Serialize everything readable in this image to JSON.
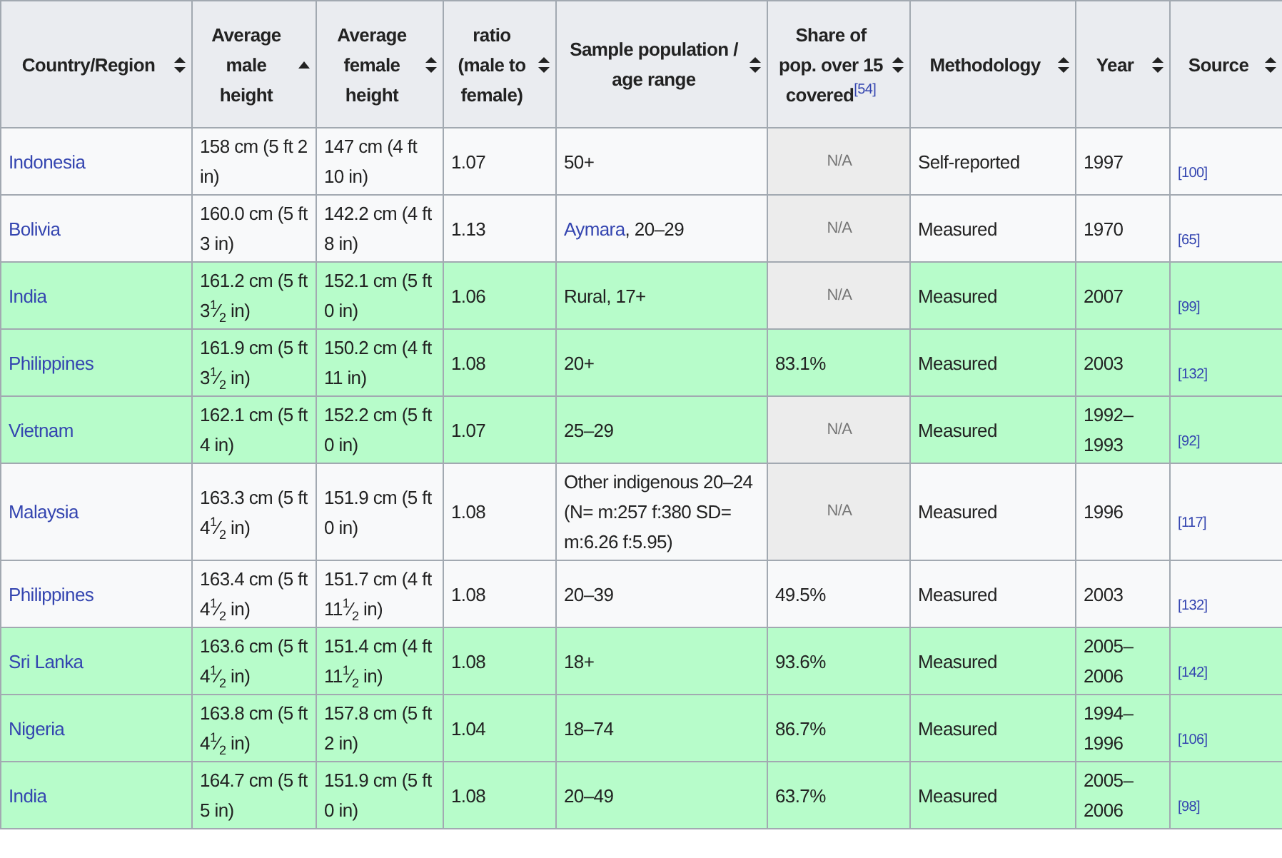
{
  "table": {
    "columns": [
      {
        "label": "Country/Region",
        "sorted": false
      },
      {
        "label": "Average male height",
        "sorted": true
      },
      {
        "label": "Average female height",
        "sorted": false
      },
      {
        "label": "ratio (male to female)",
        "sorted": false
      },
      {
        "label": "Sample population / age range",
        "sorted": false
      },
      {
        "label": "Share of pop. over 15 covered$^{[54]}$",
        "sorted": false
      },
      {
        "label": "Methodology",
        "sorted": false
      },
      {
        "label": "Year",
        "sorted": false
      },
      {
        "label": "Source",
        "sorted": false
      }
    ],
    "rows": [
      {
        "highlight": false,
        "country": "Indonesia",
        "male": "158 cm (5 ft 2 in)",
        "female": "147 cm (4 ft 10 in)",
        "ratio": "1.07",
        "sample": [
          {
            "text": "50+",
            "link": false
          }
        ],
        "share": {
          "kind": "na",
          "text": "N/A"
        },
        "method": "Self-reported",
        "year": "1997",
        "source": "[100]"
      },
      {
        "highlight": false,
        "country": "Bolivia",
        "male": "160.0 cm (5 ft 3 in)",
        "female": "142.2 cm (4 ft 8 in)",
        "ratio": "1.13",
        "sample": [
          {
            "text": "Aymara",
            "link": true
          },
          {
            "text": ", 20–29",
            "link": false
          }
        ],
        "share": {
          "kind": "na",
          "text": "N/A"
        },
        "method": "Measured",
        "year": "1970",
        "source": "[65]"
      },
      {
        "highlight": true,
        "country": "India",
        "male": "161.2 cm (5 ft 3$^{1}$⁄$_{2}$ in)",
        "female": "152.1 cm (5 ft 0 in)",
        "ratio": "1.06",
        "sample": [
          {
            "text": "Rural, 17+",
            "link": false
          }
        ],
        "share": {
          "kind": "na",
          "text": "N/A"
        },
        "method": "Measured",
        "year": "2007",
        "source": "[99]"
      },
      {
        "highlight": true,
        "country": "Philippines",
        "male": "161.9 cm (5 ft 3$^{1}$⁄$_{2}$ in)",
        "female": "150.2 cm (4 ft 11 in)",
        "ratio": "1.08",
        "sample": [
          {
            "text": "20+",
            "link": false
          }
        ],
        "share": {
          "kind": "value",
          "text": "83.1%"
        },
        "method": "Measured",
        "year": "2003",
        "source": "[132]"
      },
      {
        "highlight": true,
        "country": "Vietnam",
        "male": "162.1 cm (5 ft 4 in)",
        "female": "152.2 cm (5 ft 0 in)",
        "ratio": "1.07",
        "sample": [
          {
            "text": "25–29",
            "link": false
          }
        ],
        "share": {
          "kind": "na",
          "text": "N/A"
        },
        "method": "Measured",
        "year": "1992–1993",
        "source": "[92]"
      },
      {
        "highlight": false,
        "country": "Malaysia",
        "male": "163.3 cm (5 ft 4$^{1}$⁄$_{2}$ in)",
        "female": "151.9 cm (5 ft 0 in)",
        "ratio": "1.08",
        "sample": [
          {
            "text": "Other indigenous 20–24 (N= m:257 f:380 SD= m:6.26 f:5.95)",
            "link": false
          }
        ],
        "share": {
          "kind": "na",
          "text": "N/A"
        },
        "method": "Measured",
        "year": "1996",
        "source": "[117]"
      },
      {
        "highlight": false,
        "country": "Philippines",
        "male": "163.4 cm (5 ft 4$^{1}$⁄$_{2}$ in)",
        "female": "151.7 cm (4 ft 11$^{1}$⁄$_{2}$ in)",
        "ratio": "1.08",
        "sample": [
          {
            "text": "20–39",
            "link": false
          }
        ],
        "share": {
          "kind": "value",
          "text": "49.5%"
        },
        "method": "Measured",
        "year": "2003",
        "source": "[132]"
      },
      {
        "highlight": true,
        "country": "Sri Lanka",
        "male": "163.6 cm (5 ft 4$^{1}$⁄$_{2}$ in)",
        "female": "151.4 cm (4 ft 11$^{1}$⁄$_{2}$ in)",
        "ratio": "1.08",
        "sample": [
          {
            "text": "18+",
            "link": false
          }
        ],
        "share": {
          "kind": "value",
          "text": "93.6%"
        },
        "method": "Measured",
        "year": "2005–2006",
        "source": "[142]"
      },
      {
        "highlight": true,
        "country": "Nigeria",
        "male": "163.8 cm (5 ft 4$^{1}$⁄$_{2}$ in)",
        "female": "157.8 cm (5 ft 2 in)",
        "ratio": "1.04",
        "sample": [
          {
            "text": "18–74",
            "link": false
          }
        ],
        "share": {
          "kind": "value",
          "text": "86.7%"
        },
        "method": "Measured",
        "year": "1994–1996",
        "source": "[106]"
      },
      {
        "highlight": true,
        "country": "India",
        "male": "164.7 cm (5 ft 5 in)",
        "female": "151.9 cm (5 ft 0 in)",
        "ratio": "1.08",
        "sample": [
          {
            "text": "20–49",
            "link": false
          }
        ],
        "share": {
          "kind": "value",
          "text": "63.7%"
        },
        "method": "Measured",
        "year": "2005–2006",
        "source": "[98]"
      }
    ]
  }
}
